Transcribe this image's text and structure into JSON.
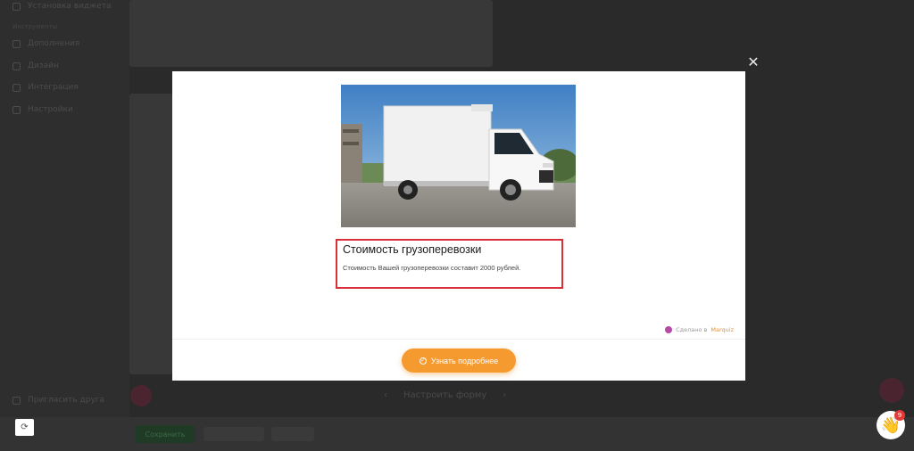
{
  "background": {
    "sidebar_items": [
      {
        "label": "Установка виджета",
        "icon": "code-icon"
      },
      {
        "label": "Дополнения",
        "icon": "puzzle-icon"
      },
      {
        "label": "Дизайн",
        "icon": "brush-icon"
      },
      {
        "label": "Интеграция",
        "icon": "link-icon"
      },
      {
        "label": "Настройки",
        "icon": "gear-icon"
      }
    ],
    "section_label": "Инструменты",
    "invite_label": "Пригласить друга",
    "save_label": "Сохранить",
    "nav_label": "Настроить форму"
  },
  "modal": {
    "close_symbol": "✕",
    "result_title": "Стоимость грузоперевозки",
    "result_text": "Стоимость Вашей грузоперевозки составит 2000 рублей.",
    "made_in_prefix": "Сделано в",
    "made_in_brand": "Marquiz",
    "cta_label": "Узнать подробнее",
    "cta_icon": "check-circle-icon"
  },
  "widgets": {
    "refresh_symbol": "⟳",
    "chat_emoji": "👋",
    "chat_badge": "9"
  },
  "colors": {
    "accent": "#f59a2f",
    "highlight": "#d7303a",
    "overlay": "#2a2a2b"
  }
}
